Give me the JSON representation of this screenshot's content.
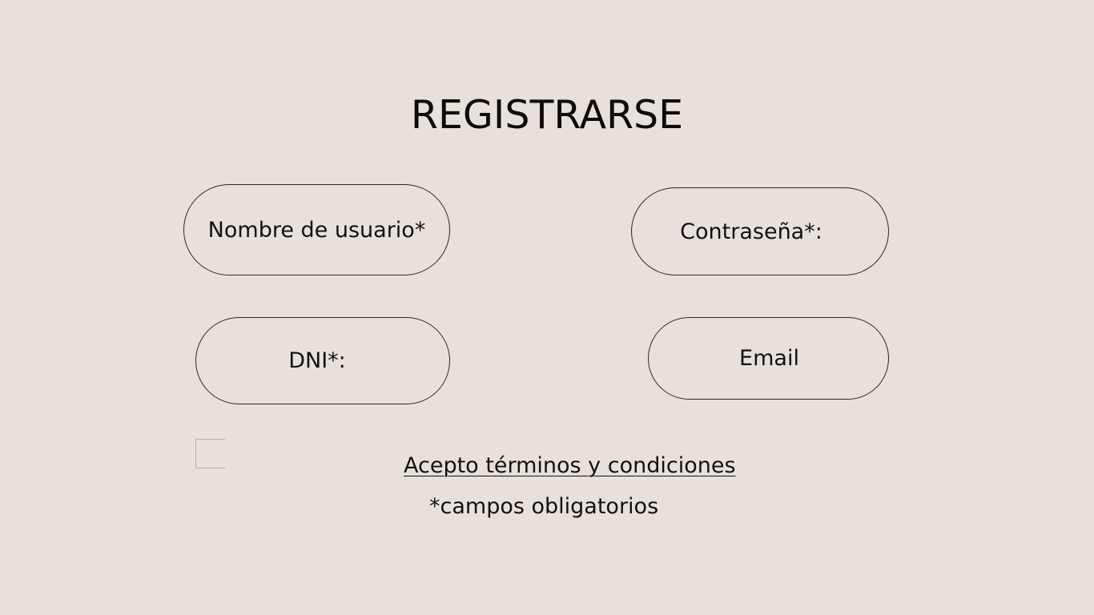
{
  "form": {
    "title": "REGISTRARSE",
    "fields": {
      "username_label": "Nombre de usuario*",
      "password_label": "Contraseña*:",
      "dni_label": "DNI*:",
      "email_label": "Email"
    },
    "terms_label": "Acepto términos y condiciones",
    "required_note": "*campos obligatorios"
  },
  "colors": {
    "background": "#e8e0db",
    "text": "#111111",
    "border": "#2a2a2a"
  }
}
